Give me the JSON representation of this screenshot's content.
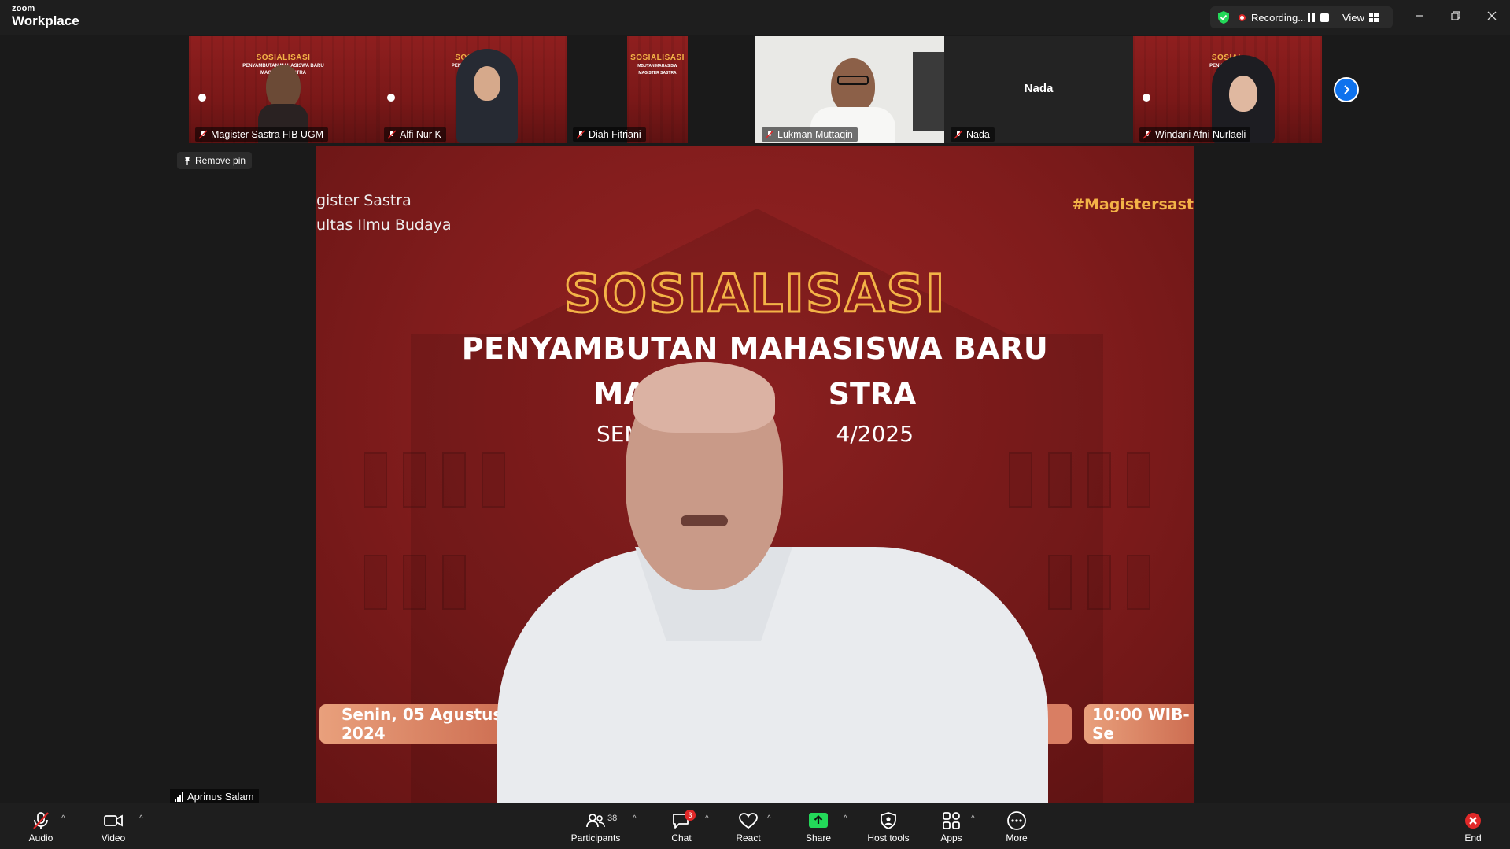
{
  "app": {
    "brand_small": "zoom",
    "brand_large": "Workplace"
  },
  "titlebar": {
    "recording_text": "Recording...",
    "view_label": "View"
  },
  "gallery": {
    "tiles": [
      {
        "name": "Magister Sastra FIB UGM",
        "slide_title": "SOSIALISASI",
        "slide_sub": "PENYAMBUTAN MAHASISWA BARU",
        "slide_sub2": "MAGISTER SASTRA"
      },
      {
        "name": "Alfi Nur K",
        "slide_title": "SOSIALI",
        "slide_sub": "PENYAMBUTAN M",
        "slide_sub2": "MAGISTI"
      },
      {
        "name": "Diah Fitriani",
        "slide_title": "SOSIALISASI",
        "slide_sub": "MBUTAN MAHASISW",
        "slide_sub2": "MAGISTER SASTRA"
      },
      {
        "name": "Lukman Muttaqin"
      },
      {
        "name": "Nada",
        "placeholder": "Nada"
      },
      {
        "name": "Windani Afni Nurlaeli",
        "slide_title": "SOSIAL",
        "slide_sub": "PENYAMBUTAN",
        "slide_sub2": "MAGISTE"
      }
    ]
  },
  "remove_pin_label": "Remove pin",
  "slide": {
    "header_left_1": "gister Sastra",
    "header_left_2": "ultas Ilmu Budaya",
    "hashtag": "#Magistersast",
    "title": "SOSIALISASI",
    "line1": "PENYAMBUTAN MAHASISWA BARU",
    "line2": "MAGIST          STRA",
    "line3": "SEMESTER G              4/2025",
    "date": "Senin, 05 Agustus 2024",
    "time": "10:00 WIB-Se"
  },
  "speaker_name": "Aprinus Salam",
  "toolbar": {
    "audio": "Audio",
    "video": "Video",
    "participants": "Participants",
    "participants_count": "38",
    "chat": "Chat",
    "chat_badge": "3",
    "react": "React",
    "share": "Share",
    "host_tools": "Host tools",
    "apps": "Apps",
    "more": "More",
    "end": "End"
  },
  "colors": {
    "accent_blue": "#0e72ed",
    "share_green": "#23d959",
    "slide_red": "#8b1c1c",
    "gold": "#f3b347",
    "end_red": "#e02828"
  }
}
